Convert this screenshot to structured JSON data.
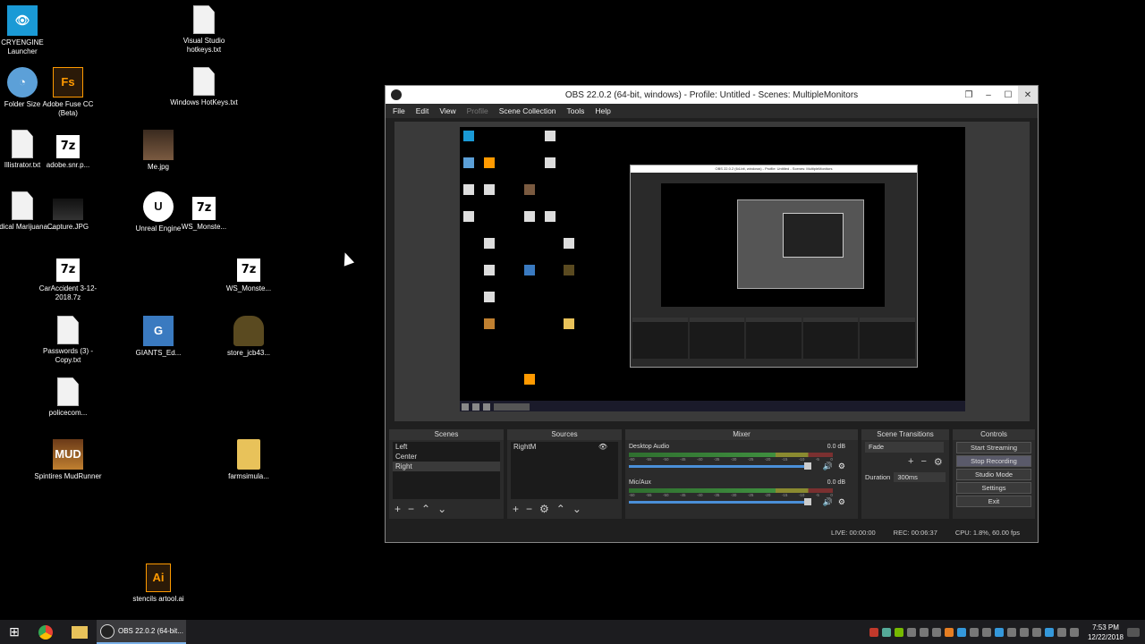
{
  "desktop": {
    "icons": [
      {
        "label": "CRYENGINE Launcher",
        "glyph": "👁"
      },
      {
        "label": "Folder Size",
        "glyph": "◔"
      },
      {
        "label": "Illistrator.txt",
        "glyph": ""
      },
      {
        "label": "Medical Marijuana....",
        "glyph": ""
      },
      {
        "label": "Adobe Fuse CC (Beta)",
        "glyph": "Fs"
      },
      {
        "label": "adobe.snr.p...",
        "glyph": "7z"
      },
      {
        "label": "Capture.JPG",
        "glyph": ""
      },
      {
        "label": "CarAccident 3-12-2018.7z",
        "glyph": "7z"
      },
      {
        "label": "Passwords (3) - Copy.txt",
        "glyph": ""
      },
      {
        "label": "policecom...",
        "glyph": ""
      },
      {
        "label": "Spintires MudRunner",
        "glyph": "MUD"
      },
      {
        "label": "Me.jpg",
        "glyph": ""
      },
      {
        "label": "Unreal Engine",
        "glyph": "U"
      },
      {
        "label": "GIANTS_Ed...",
        "glyph": "G"
      },
      {
        "label": "stencils artool.ai",
        "glyph": "Ai"
      },
      {
        "label": "Visual Studio hotkeys.txt",
        "glyph": ""
      },
      {
        "label": "Windows HotKeys.txt",
        "glyph": ""
      },
      {
        "label": "WS_Monste...",
        "glyph": "7z"
      },
      {
        "label": "WS_Monste...",
        "glyph": "7z"
      },
      {
        "label": "store_jcb43...",
        "glyph": ""
      },
      {
        "label": "farmsimula...",
        "glyph": ""
      }
    ]
  },
  "obs": {
    "title": "OBS 22.0.2 (64-bit, windows) - Profile: Untitled - Scenes: MultipleMonitors",
    "menu": [
      "File",
      "Edit",
      "View",
      "Profile",
      "Scene Collection",
      "Tools",
      "Help"
    ],
    "nested_title": "OBS 22.0.2 (64-bit, windows) - Profile: Untitled - Scenes: MultipleMonitors",
    "docks": {
      "scenes_title": "Scenes",
      "sources_title": "Sources",
      "mixer_title": "Mixer",
      "transitions_title": "Scene Transitions",
      "controls_title": "Controls"
    },
    "scenes": [
      "Left",
      "Center",
      "Right"
    ],
    "selected_scene": "Right",
    "sources": [
      "RightM"
    ],
    "mixer": [
      {
        "name": "Desktop Audio",
        "db": "0.0 dB"
      },
      {
        "name": "Mic/Aux",
        "db": "0.0 dB"
      }
    ],
    "meter_ticks": [
      "-60",
      "-55",
      "-50",
      "-45",
      "-40",
      "-35",
      "-30",
      "-25",
      "-20",
      "-15",
      "-10",
      "-5",
      "0"
    ],
    "transition": {
      "selected": "Fade",
      "duration_label": "Duration",
      "duration_value": "300ms"
    },
    "controls": [
      "Start Streaming",
      "Stop Recording",
      "Studio Mode",
      "Settings",
      "Exit"
    ],
    "status": {
      "live": "LIVE: 00:00:00",
      "rec": "REC: 00:06:37",
      "cpu": "CPU: 1.8%, 60.00 fps"
    }
  },
  "taskbar": {
    "obs_label": "OBS 22.0.2 (64-bit...",
    "time": "7:53 PM",
    "date": "12/22/2018"
  }
}
